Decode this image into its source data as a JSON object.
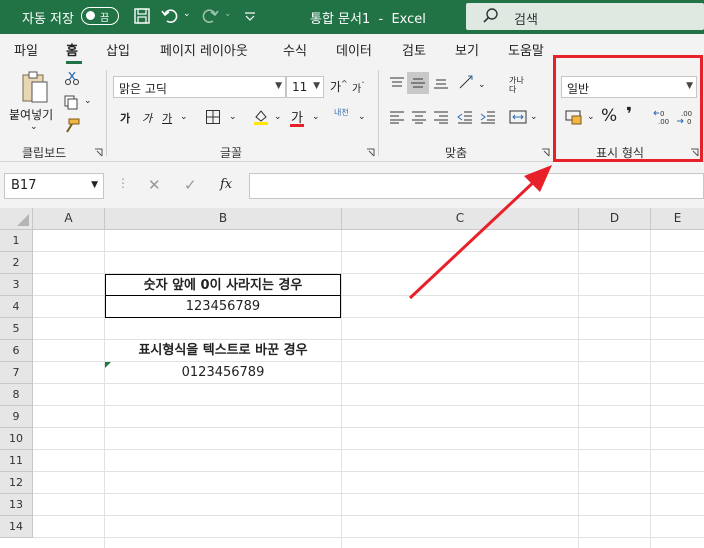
{
  "titlebar": {
    "autosave_label": "자동 저장",
    "autosave_state": "끔",
    "doc_title": "통합 문서1  -  Excel",
    "search_placeholder": "검색"
  },
  "tabs": [
    "파일",
    "홈",
    "삽입",
    "페이지 레이아웃",
    "수식",
    "데이터",
    "검토",
    "보기",
    "도움말"
  ],
  "active_tab": "홈",
  "ribbon": {
    "clipboard": {
      "paste_label": "붙여넣기",
      "group_label": "클립보드"
    },
    "font": {
      "font_name": "맑은 고딕",
      "font_size": "11",
      "bold": "가",
      "italic": "가",
      "underline": "가",
      "font_color_glyph": "가",
      "phonetic": "내천",
      "grow": "가",
      "shrink": "가",
      "group_label": "글꼴"
    },
    "alignment": {
      "group_label": "맞춤",
      "wrap_glyph": "가나다"
    },
    "number": {
      "format_value": "일반",
      "percent": "%",
      "comma": "❜",
      "group_label": "표시 형식"
    }
  },
  "formula_bar": {
    "name_box": "B17",
    "fx": "fx",
    "formula": ""
  },
  "sheet": {
    "columns": [
      "A",
      "B",
      "C",
      "D",
      "E"
    ],
    "rows": [
      "1",
      "2",
      "3",
      "4",
      "5",
      "6",
      "7",
      "8",
      "9",
      "10",
      "11",
      "12",
      "13",
      "14"
    ],
    "cells": {
      "B3": "숫자 앞에 0이 사라지는 경우",
      "B4": "123456789",
      "B6": "표시형식을 텍스트로 바꾼 경우",
      "B7": "0123456789"
    }
  },
  "colors": {
    "excel_green": "#217346",
    "highlight_red": "#e8202a"
  }
}
